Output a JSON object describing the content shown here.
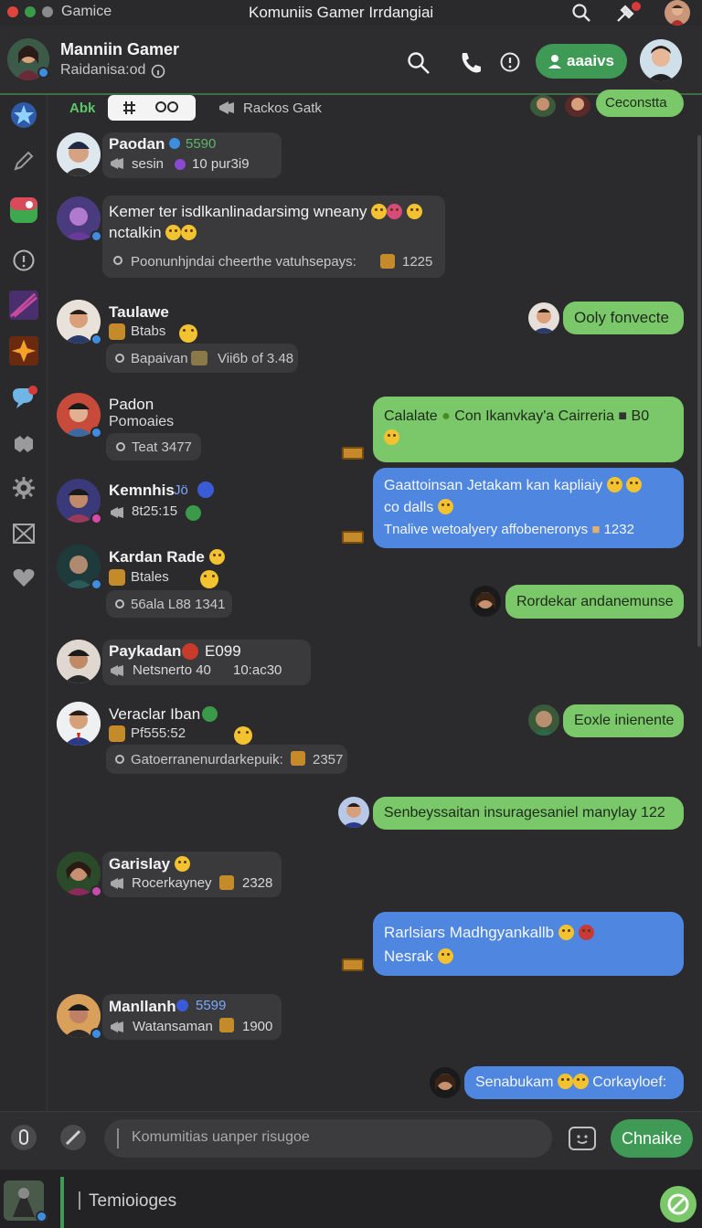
{
  "titlebar": {
    "app_name": "Gamice",
    "window_title": "Komuniis Gamer Irrdangiai"
  },
  "header": {
    "title": "Manniin Gamer",
    "subtitle": "Raidanisa:od",
    "join_label": "aaaivs"
  },
  "tabs": {
    "tab1": "Abk",
    "tab2": "Rackos Gatk",
    "right_label": "Ceconstta"
  },
  "messages": [
    {
      "name": "Paodan",
      "name_tag": "5590",
      "line": "sesin",
      "line_tag": "10 pur3i9"
    },
    {
      "text1": "Kemer ter  isdlkanlinadarsimg wneany",
      "text2": "nctalkin",
      "meta": "Poonunhjndai cheerthe vatuhsepays:",
      "meta_num": "1225"
    },
    {
      "name": "Taulawe",
      "line": "Btabs",
      "meta": "Bapaivan",
      "meta_num": "Vii6b of 3.48"
    },
    {
      "name": "Padon",
      "line": "Pomoaies",
      "meta": "Teat  3477"
    },
    {
      "name": "Kemnhis",
      "name_tag": "Jö",
      "line": "8t25:15"
    },
    {
      "name": "Kardan Rade",
      "line": "Btales",
      "meta": "56ala L88  1341"
    },
    {
      "name": "Paykadan",
      "name_tag": "E099",
      "line": "Netsnerto 40",
      "line_tag": "10:ac30"
    },
    {
      "name": "Veraclar Iban",
      "line": "Pf555:52",
      "meta": "Gatoerranenurdarkepuik:",
      "meta_num": "2357"
    },
    {
      "name": "Garislay",
      "line": "Rocerkayney",
      "line_tag": "2328"
    },
    {
      "name": "Manllanh",
      "name_tag": "5599",
      "line": "Watansaman",
      "line_tag": "1900"
    }
  ],
  "bubbles": {
    "b1": "Ooly fonvecte",
    "b2a": "Calalate",
    "b2b": "Con Ikanvkay'a Cairreria",
    "b2c": "B0",
    "b3a": "Gaattoinsan Jetakam kan kapliaiy",
    "b3b": "co dalls",
    "b3c": "Tnalive wetoalyery affobeneronys",
    "b3d": "1232",
    "b4": "Rordekar andanemunse",
    "b5": "Eoxle inienente",
    "b6": "Senbeyssaitan insuragesaniel manylay 122",
    "b7a": "Rarlsiars Madhgyankallb",
    "b7b": "Nesrak",
    "b8a": "Senabukam",
    "b8b": "Corkayloef:"
  },
  "composer": {
    "placeholder": "Komumitias uanper risugoe",
    "send_label": "Chnaike"
  },
  "bottom": {
    "placeholder": "Temioioges"
  },
  "colors": {
    "accent_green": "#7bc86a",
    "accent_blue": "#4e86e0",
    "header_button": "#3f9a55"
  },
  "icons": [
    "search-icon",
    "pin-icon",
    "phone-icon",
    "info-icon",
    "person-icon",
    "pencil-icon",
    "chat-icon",
    "settings-icon",
    "heart-icon",
    "attach-icon",
    "emoji-icon"
  ]
}
